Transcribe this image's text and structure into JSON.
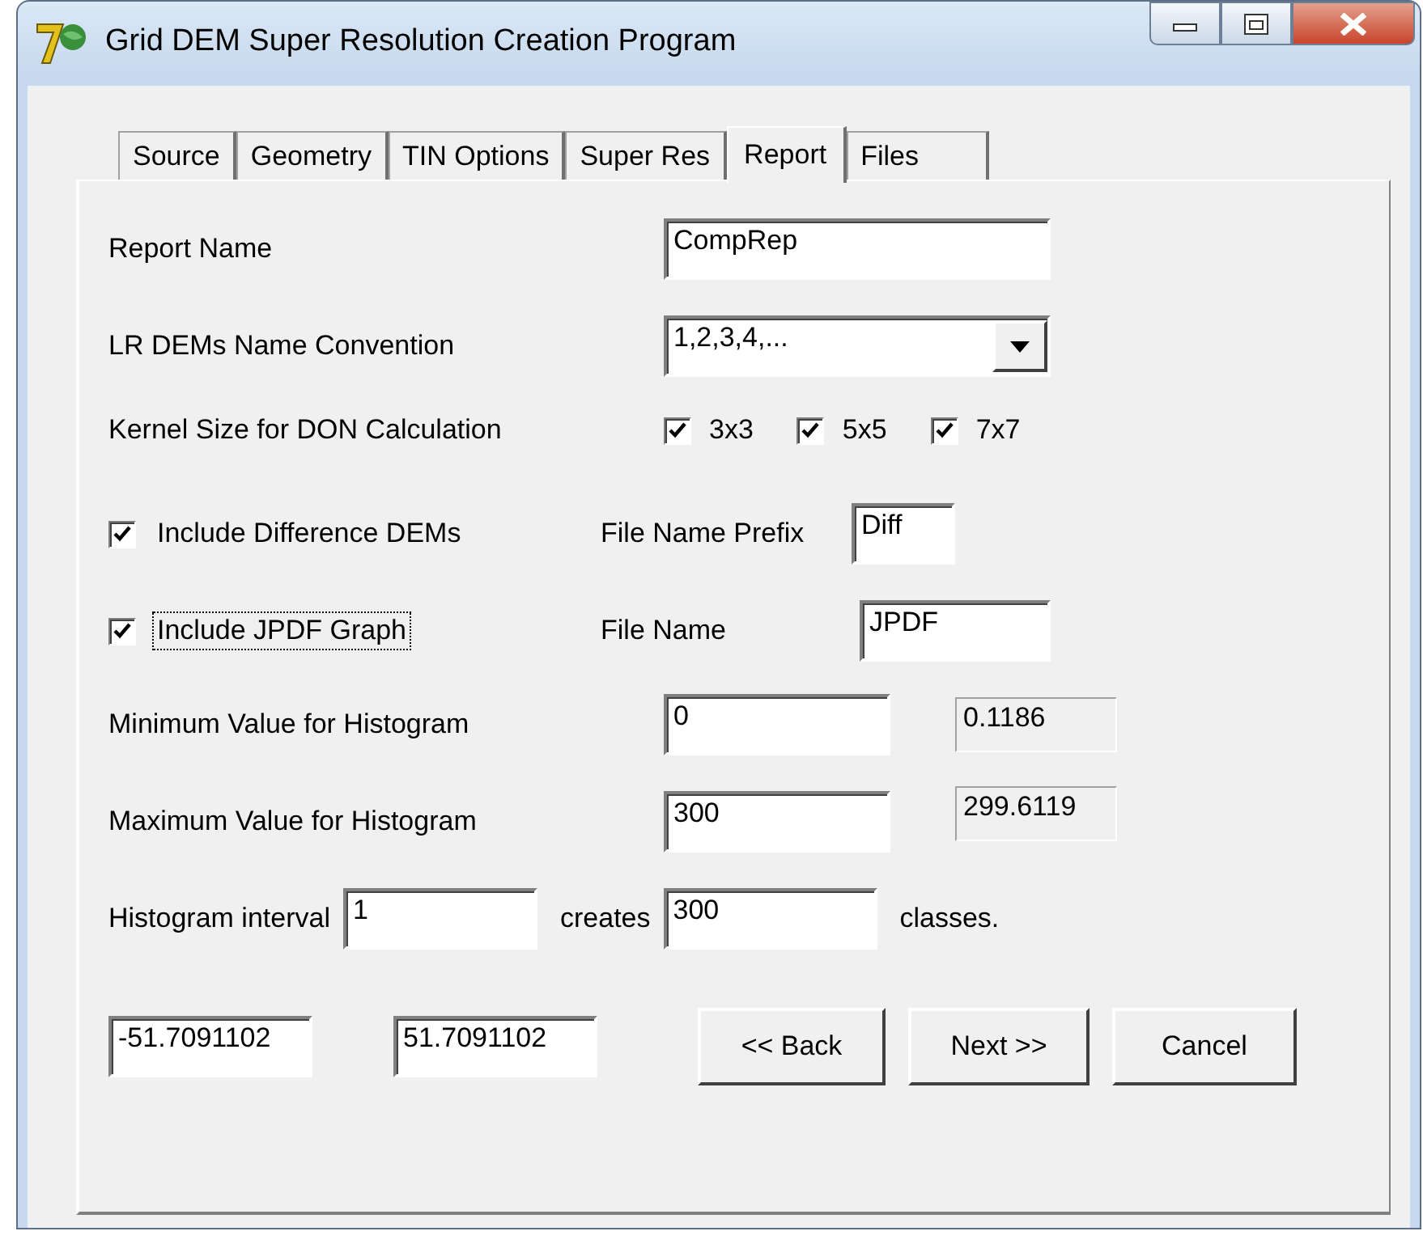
{
  "window": {
    "title": "Grid DEM Super Resolution Creation Program"
  },
  "tabs": [
    {
      "label": "Source",
      "selected": false
    },
    {
      "label": "Geometry",
      "selected": false
    },
    {
      "label": "TIN Options",
      "selected": false
    },
    {
      "label": "Super Res",
      "selected": false
    },
    {
      "label": "Report",
      "selected": true
    },
    {
      "label": "Files",
      "selected": false
    }
  ],
  "report_name": {
    "label": "Report Name",
    "value": "CompRep"
  },
  "name_convention": {
    "label": "LR DEMs Name Convention",
    "value": "1,2,3,4,..."
  },
  "kernel_size": {
    "label": "Kernel Size for DON Calculation",
    "options": [
      {
        "label": "3x3",
        "checked": true
      },
      {
        "label": "5x5",
        "checked": true
      },
      {
        "label": "7x7",
        "checked": true
      }
    ]
  },
  "difference_dems": {
    "label": "Include Difference DEMs",
    "checked": true,
    "focused": false,
    "file_label": "File Name Prefix",
    "file_value": "Diff"
  },
  "jpdf_graph": {
    "label": "Include JPDF Graph",
    "checked": true,
    "focused": true,
    "file_label": "File Name",
    "file_value": "JPDF"
  },
  "histogram_min": {
    "label": "Minimum Value for Histogram",
    "value": "0",
    "computed": "0.1186"
  },
  "histogram_max": {
    "label": "Maximum Value for Histogram",
    "value": "300",
    "computed": "299.6119"
  },
  "histogram_interval": {
    "label": "Histogram interval",
    "value": "1",
    "creates_label": "creates",
    "classes_value": "300",
    "classes_label": "classes."
  },
  "range_fields": [
    "-51.7091102",
    "51.7091102"
  ],
  "buttons": [
    "<< Back",
    "Next >>",
    "Cancel"
  ]
}
